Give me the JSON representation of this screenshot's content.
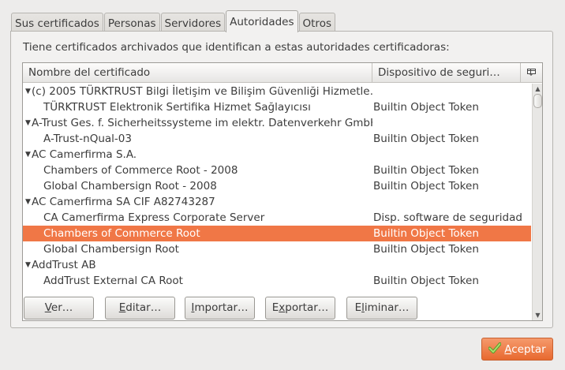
{
  "tabs": [
    {
      "label": "Sus certificados",
      "active": false
    },
    {
      "label": "Personas",
      "active": false
    },
    {
      "label": "Servidores",
      "active": false
    },
    {
      "label": "Autoridades",
      "active": true
    },
    {
      "label": "Otros",
      "active": false
    }
  ],
  "description": "Tiene certificados archivados que identifican a estas autoridades certificadoras:",
  "table": {
    "columns": [
      "Nombre del certificado",
      "Dispositivo de seguri…"
    ],
    "rows": [
      {
        "name": "(c) 2005 TÜRKTRUST Bilgi İletişim ve Bilişim Güvenliği Hizmetle…",
        "device": "",
        "group": true,
        "expanded": true
      },
      {
        "name": "TÜRKTRUST Elektronik Sertifika Hizmet Sağlayıcısı",
        "device": "Builtin Object Token",
        "group": false
      },
      {
        "name": "A-Trust Ges. f. Sicherheitssysteme im elektr. Datenverkehr GmbH",
        "device": "",
        "group": true,
        "expanded": true
      },
      {
        "name": "A-Trust-nQual-03",
        "device": "Builtin Object Token",
        "group": false
      },
      {
        "name": "AC Camerfirma S.A.",
        "device": "",
        "group": true,
        "expanded": true
      },
      {
        "name": "Chambers of Commerce Root - 2008",
        "device": "Builtin Object Token",
        "group": false
      },
      {
        "name": "Global Chambersign Root - 2008",
        "device": "Builtin Object Token",
        "group": false
      },
      {
        "name": "AC Camerfirma SA CIF A82743287",
        "device": "",
        "group": true,
        "expanded": true
      },
      {
        "name": "CA Camerfirma Express Corporate Server",
        "device": "Disp. software de seguridad",
        "group": false
      },
      {
        "name": "Chambers of Commerce Root",
        "device": "Builtin Object Token",
        "group": false,
        "selected": true
      },
      {
        "name": "Global Chambersign Root",
        "device": "Builtin Object Token",
        "group": false
      },
      {
        "name": "AddTrust AB",
        "device": "",
        "group": true,
        "expanded": true
      },
      {
        "name": "AddTrust External CA Root",
        "device": "Builtin Object Token",
        "group": false
      }
    ]
  },
  "buttons": {
    "view": {
      "mnemonic": "V",
      "rest": "er…"
    },
    "edit": {
      "mnemonic": "E",
      "rest": "ditar…"
    },
    "import": {
      "mnemonic": "I",
      "rest": "mportar…"
    },
    "export": {
      "pre": "E",
      "mnemonic": "x",
      "rest": "portar…"
    },
    "delete": {
      "pre": "E",
      "mnemonic": "l",
      "rest": "iminar…"
    }
  },
  "accept": {
    "mnemonic": "A",
    "rest": "ceptar"
  },
  "icons": {
    "expander": "triangle-down-icon",
    "column_picker": "column-picker-icon",
    "accept": "checkmark-icon"
  },
  "colors": {
    "selection": "#f07746",
    "accept_button": "#ee7a44",
    "accept_check": "#7cbb3c"
  }
}
